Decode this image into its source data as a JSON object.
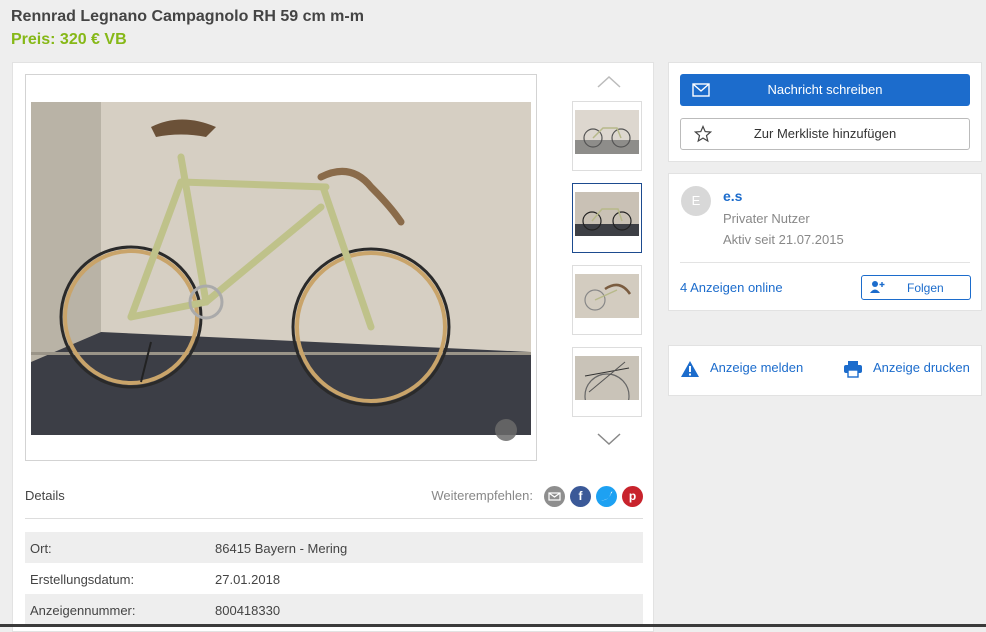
{
  "listing": {
    "title": "Rennrad Legnano Campagnolo RH 59 cm m-m",
    "price": "Preis: 320 € VB"
  },
  "details": {
    "heading": "Details",
    "share_label": "Weiterempfehlen:",
    "share_icons": [
      "email-icon",
      "facebook-icon",
      "twitter-icon",
      "pinterest-icon"
    ],
    "attributes": [
      {
        "key": "Ort:",
        "value": "86415 Bayern - Mering"
      },
      {
        "key": "Erstellungsdatum:",
        "value": "27.01.2018"
      },
      {
        "key": "Anzeigennummer:",
        "value": "800418330"
      }
    ]
  },
  "actions": {
    "message_label": "Nachricht schreiben",
    "watchlist_label": "Zur Merkliste hinzufügen"
  },
  "seller": {
    "avatar_letter": "E",
    "name": "e.s",
    "type": "Privater Nutzer",
    "active_since": "Aktiv seit 21.07.2015",
    "ads_online": "4 Anzeigen online",
    "follow_label": "Folgen"
  },
  "report": {
    "report_label": "Anzeige melden",
    "print_label": "Anzeige drucken"
  },
  "colors": {
    "accent": "#1c6ccc",
    "price": "#86b817"
  }
}
